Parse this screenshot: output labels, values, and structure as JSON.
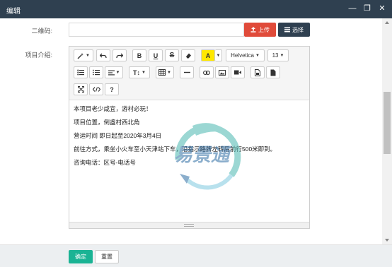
{
  "window": {
    "title": "编辑",
    "minimize_glyph": "—",
    "maximize_glyph": "❐",
    "close_glyph": "✕"
  },
  "form": {
    "qrcode_label": "二维码:",
    "qrcode_value": "",
    "upload_label": "上传",
    "select_label": "选择",
    "intro_label": "项目介绍:"
  },
  "editor": {
    "toolbar": {
      "font_family": "Helvetica",
      "font_size": "13",
      "bold": "B",
      "underline": "U",
      "strike": "S",
      "highlight": "A",
      "heading": "T↕",
      "help": "?"
    },
    "content_lines": [
      "本项目老少咸宜，游村必玩！",
      "项目位置，倒盏村西北角",
      "营运时间 即日起至2020年3月4日",
      "前往方式，乘坐小火车至小天津站下车，沿指示路牌左转后前行500米即到。",
      "咨询电话：区号-电话号"
    ]
  },
  "watermark": {
    "text": "易景通",
    "colors": [
      "#4bb8b0",
      "#2e6da4"
    ]
  },
  "footer": {
    "confirm_label": "确定",
    "reset_label": "重置"
  },
  "colors": {
    "titlebar": "#2f4050",
    "upload": "#e04b3a",
    "select": "#2f4050",
    "confirm": "#1ab394"
  }
}
